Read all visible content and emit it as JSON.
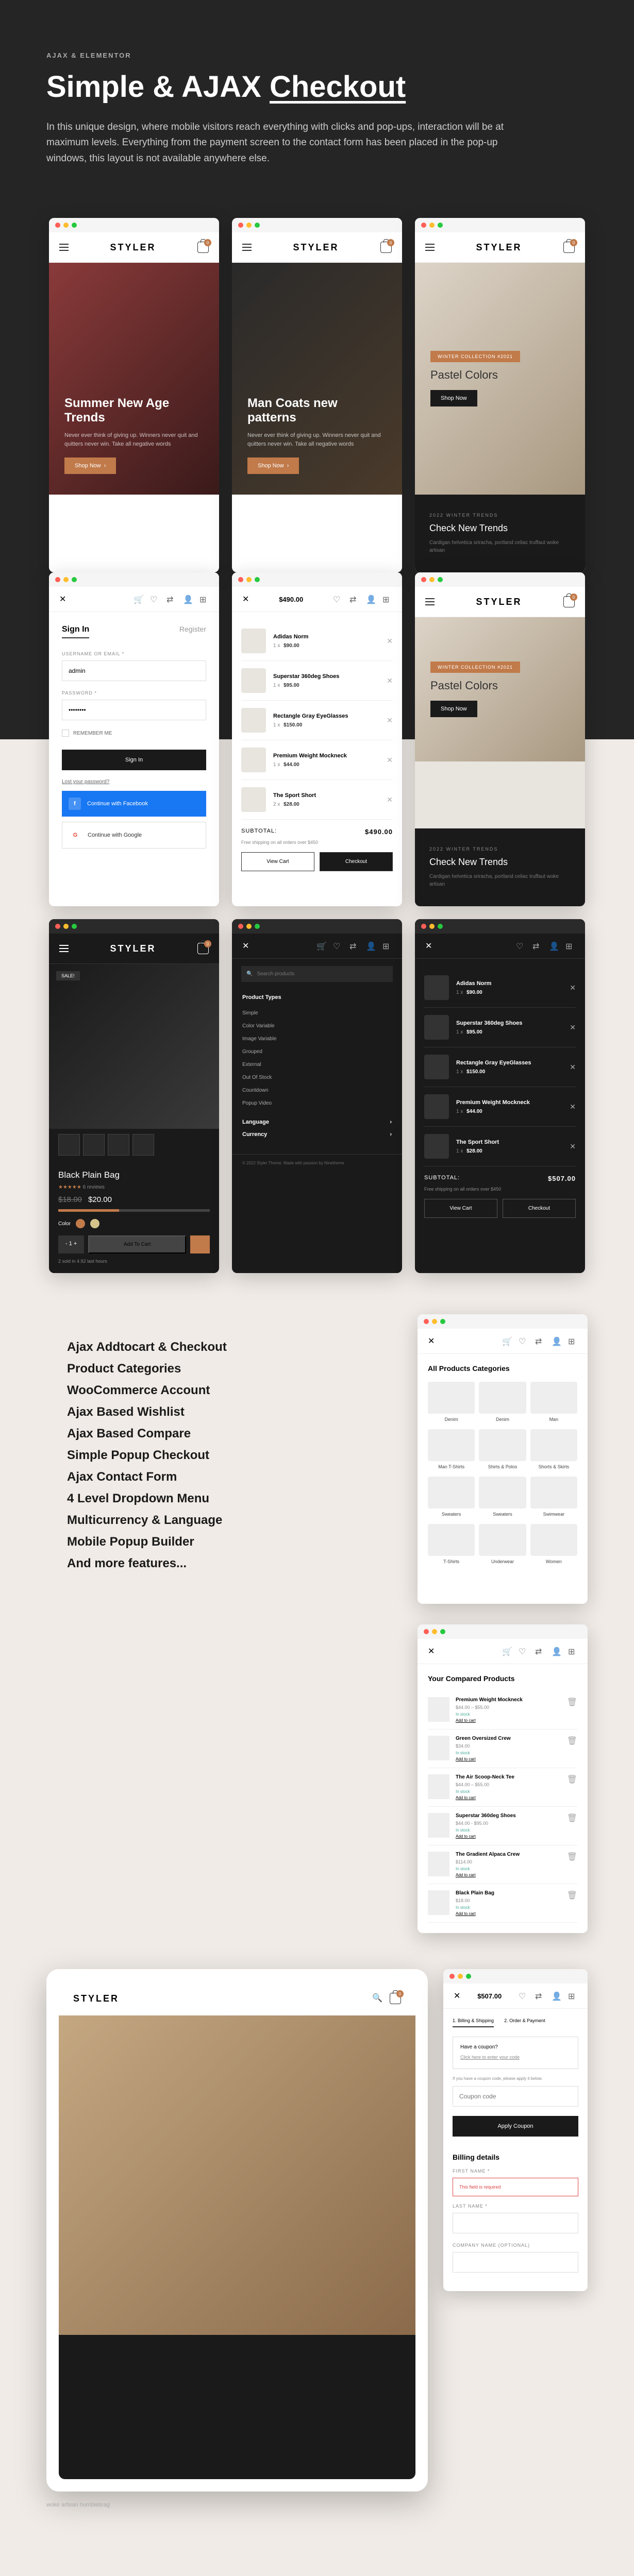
{
  "hero": {
    "eyebrow": "AJAX & ELEMENTOR",
    "title_a": "Simple & AJAX ",
    "title_b": "Checkout",
    "desc": "In this unique design, where mobile visitors reach everything with clicks and pop-ups, interaction will be at maximum levels. Everything from the payment screen to the contact form has been placed in the pop-up windows, this layout is not available anywhere else."
  },
  "brand": "STYLER",
  "screen1": {
    "title": "Summer New Age Trends",
    "sub": "Never ever think of giving up. Winners never quit and quitters never win. Take all negative words",
    "btn": "Shop Now"
  },
  "screen2": {
    "title": "Man Coats new patterns",
    "sub": "Never ever think of giving up. Winners never quit and quitters never win. Take all negative words",
    "btn": "Shop Now"
  },
  "screen3": {
    "banner": "WINTER COLLECTION #2021",
    "title": "Pastel Colors",
    "btn": "Shop Now",
    "trends_eyebrow": "2022 WINTER TRENDS",
    "trends_title": "Check New Trends",
    "trends_desc": "Cardigan helvetica sriracha, portland celiac truffaut woke artisan"
  },
  "signin": {
    "tab_signin": "Sign In",
    "tab_register": "Register",
    "label_user": "USERNAME OR EMAIL *",
    "val_user": "admin",
    "label_pass": "PASSWORD *",
    "remember": "REMEMBER ME",
    "btn": "Sign In",
    "lost": "Lost your password?",
    "fb": "Continue with Facebook",
    "gg": "Continue with Google"
  },
  "cart": {
    "total_top": "$490.00",
    "items": [
      {
        "name": "Adidas Norm",
        "qty": "1",
        "price": "$90.00"
      },
      {
        "name": "Superstar 360deg Shoes",
        "qty": "1",
        "price": "$95.00"
      },
      {
        "name": "Rectangle Gray EyeGlasses",
        "qty": "1",
        "price": "$150.00"
      },
      {
        "name": "Premium Weight Mockneck",
        "qty": "1",
        "price": "$44.00"
      },
      {
        "name": "The Sport Short",
        "qty": "2",
        "price": "$28.00"
      }
    ],
    "subtotal_label": "SUBTOTAL:",
    "subtotal": "$490.00",
    "ship": "Free shipping on all orders over $450",
    "btn_view": "View Cart",
    "btn_checkout": "Checkout"
  },
  "cart_dark": {
    "items": [
      {
        "name": "Adidas Norm",
        "price": "$90.00"
      },
      {
        "name": "Superstar 360deg Shoes",
        "price": "$95.00"
      },
      {
        "name": "Rectangle Gray EyeGlasses",
        "price": "$150.00"
      },
      {
        "name": "Premium Weight Mockneck",
        "price": "$44.00"
      },
      {
        "name": "The Sport Short",
        "price": "$28.00"
      }
    ],
    "subtotal": "$507.00"
  },
  "product": {
    "badge": "SALE!",
    "title": "Black Plain Bag",
    "reviews": "6 reviews",
    "price_old": "$18.00",
    "price_new": "$20.00",
    "color_label": "Color",
    "qty": "- 1 +",
    "add": "Add To Cart",
    "note": "2 sold in 4.92 last hours"
  },
  "filters": {
    "search_ph": "Search products",
    "heading": "Product Types",
    "types": [
      "Simple",
      "Color Variable",
      "Image Variable",
      "Grouped",
      "External",
      "Out Of Stock",
      "Countdown",
      "Popup Video"
    ],
    "lang": "Language",
    "curr": "Currency",
    "footer": "© 2022 Styler Theme. Made with passion by Ninetheme"
  },
  "features": [
    "Ajax Addtocart & Checkout",
    "Product Categories",
    "WooCommerce Account",
    "Ajax Based Wishlist",
    "Ajax Based Compare",
    "Simple Popup Checkout",
    "Ajax Contact Form",
    "4 Level Dropdown Menu",
    "Multicurrency & Language",
    "Mobile Popup Builder",
    "And more features..."
  ],
  "categories": {
    "title": "All Products Categories",
    "items": [
      "Denim",
      "Denim",
      "Man",
      "Man T-Shirts",
      "Shirts & Polos",
      "Shorts & Skirts",
      "Sweaters",
      "Sweaters",
      "Swimwear",
      "T-Shirts",
      "Underwear",
      "Women"
    ]
  },
  "compare": {
    "title": "Your Compared Products",
    "items": [
      {
        "name": "Premium Weight Mockneck",
        "price": "$44.00 – $55.00",
        "stock": "In stock"
      },
      {
        "name": "Green Oversized Crew",
        "price": "$34.00",
        "stock": "In stock"
      },
      {
        "name": "The Air Scoop-Neck Tee",
        "price": "$44.00 – $55.00",
        "stock": "In stock"
      },
      {
        "name": "Superstar 360deg Shoes",
        "price": "$44.00 - $95.00",
        "stock": "In stock"
      },
      {
        "name": "The Gradient Alpaca Crew",
        "price": "$114.00",
        "stock": "In stock"
      },
      {
        "name": "Black Plain Bag",
        "price": "$18.00",
        "stock": "In stock"
      }
    ],
    "add": "Add to cart"
  },
  "checkout": {
    "total": "$507.00",
    "step1": "1. Billing & Shipping",
    "step2": "2. Order & Payment",
    "coupon_q": "Have a coupon?",
    "coupon_link": "Click here to enter your code",
    "coupon_note": "If you have a coupon code, please apply it below.",
    "coupon_ph": "Coupon code",
    "coupon_btn": "Apply Coupon",
    "billing": "Billing details",
    "fname": "FIRST NAME *",
    "required": "This field is required",
    "lname": "LAST NAME *",
    "company": "COMPANY NAME (OPTIONAL)"
  },
  "credit": "woke artisan\nhumblebrag"
}
